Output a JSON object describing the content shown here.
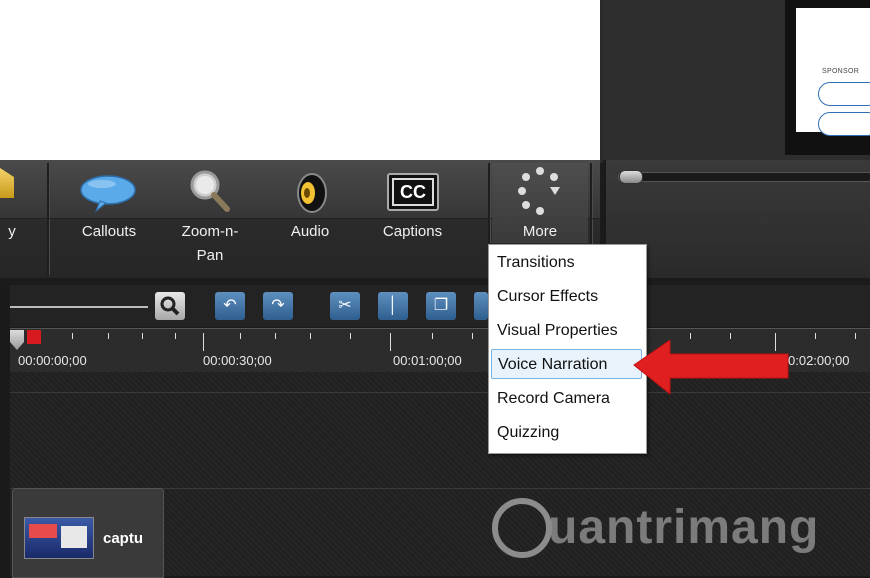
{
  "toolbar": {
    "partial_label": "y",
    "items": [
      {
        "label": "Callouts",
        "icon": "callouts-icon"
      },
      {
        "label": "Zoom-n-\nPan",
        "icon": "zoom-icon"
      },
      {
        "label": "Audio",
        "icon": "audio-icon"
      },
      {
        "label": "Captions",
        "icon": "captions-icon",
        "icon_text": "CC"
      },
      {
        "label": "More",
        "icon": "more-icon"
      }
    ]
  },
  "zoom_pan_line1": "Zoom-n-",
  "zoom_pan_line2": "Pan",
  "preview": {
    "sponsor_text": "SPONSOR"
  },
  "more_menu": {
    "items": [
      {
        "label": "Transitions",
        "highlighted": false
      },
      {
        "label": "Cursor Effects",
        "highlighted": false
      },
      {
        "label": "Visual Properties",
        "highlighted": false
      },
      {
        "label": "Voice Narration",
        "highlighted": true
      },
      {
        "label": "Record Camera",
        "highlighted": false
      },
      {
        "label": "Quizzing",
        "highlighted": false
      }
    ]
  },
  "timeline": {
    "timecodes": [
      "00:00:00;00",
      "00:00:30;00",
      "00:01:00;00",
      "0:02:00;00"
    ],
    "clip_label": "captu"
  },
  "watermark": "uantrimang",
  "colors": {
    "highlight": "#e8f2fb",
    "arrow": "#e02020",
    "accent": "#2f6fb4"
  }
}
